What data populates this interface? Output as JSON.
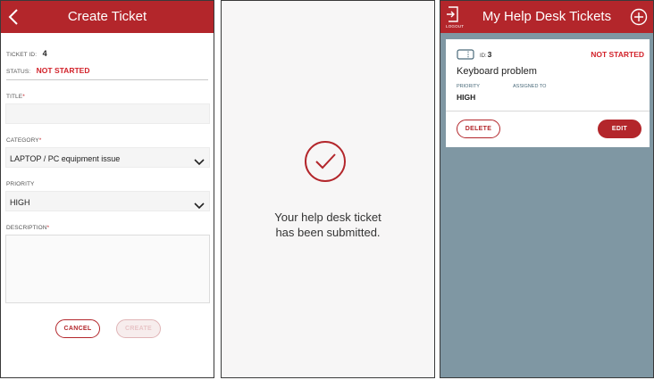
{
  "create_screen": {
    "title": "Create Ticket",
    "ticket_id_label": "TICKET ID:",
    "ticket_id_value": "4",
    "status_label": "STATUS:",
    "status_value": "NOT STARTED",
    "title_label": "TITLE",
    "title_value": "",
    "category_label": "CATEGORY",
    "category_value": "LAPTOP / PC equipment issue",
    "priority_label": "PRIORITY",
    "priority_value": "HIGH",
    "description_label": "DESCRIPTION",
    "description_value": "",
    "required_mark": "*",
    "cancel_label": "CANCEL",
    "create_label": "CREATE"
  },
  "confirmation_screen": {
    "line1": "Your help desk ticket",
    "line2": "has been submitted."
  },
  "tickets_screen": {
    "title": "My Help Desk Tickets",
    "logout_label": "LOGOUT",
    "ticket": {
      "id_label": "ID:",
      "id_value": "3",
      "status": "NOT STARTED",
      "title": "Keyboard problem",
      "priority_label": "PRIORITY",
      "priority_value": "HIGH",
      "assigned_label": "ASSIGNED TO",
      "delete_label": "DELETE",
      "edit_label": "EDIT"
    }
  },
  "colors": {
    "brand_red": "#b3262b",
    "status_red": "#d2222a",
    "list_background": "#7f97a3"
  },
  "icons": [
    "back-arrow-icon",
    "chevron-down-icon",
    "checkmark-circle-icon",
    "logout-icon",
    "add-circle-icon",
    "ticket-icon"
  ]
}
